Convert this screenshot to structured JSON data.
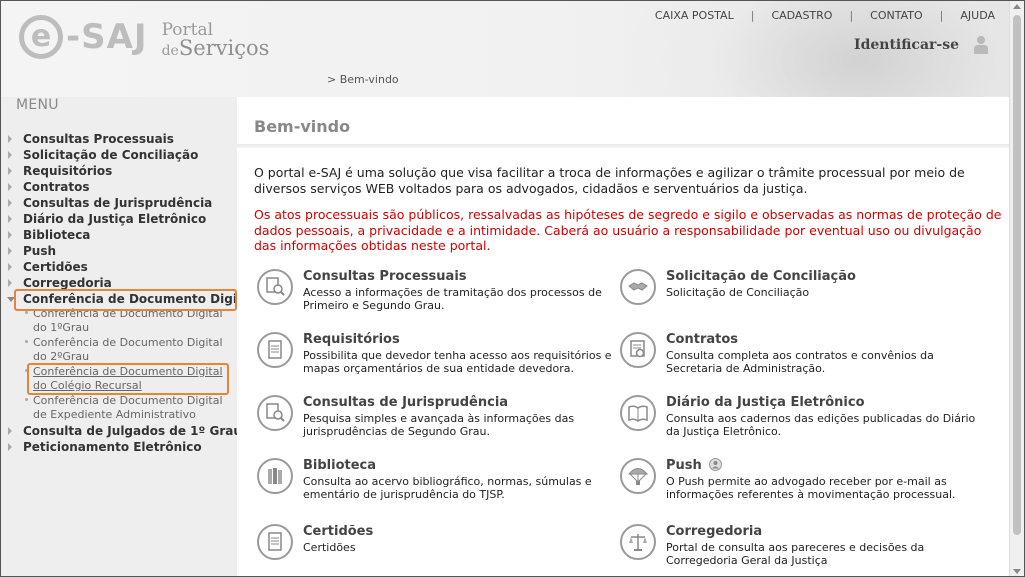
{
  "header": {
    "logo_text": "e-SAJ",
    "logo_portal_line1": "Portal",
    "logo_portal_line2_prefix": "de",
    "logo_portal_line2_main": "Serviços",
    "top_links": [
      "CAIXA POSTAL",
      "CADASTRO",
      "CONTATO",
      "AJUDA"
    ],
    "identify_label": "Identificar-se",
    "breadcrumb": "> Bem-vindo"
  },
  "sidebar": {
    "menu_title": "MENU",
    "items": [
      "Consultas Processuais",
      "Solicitação de Conciliação",
      "Requisitórios",
      "Contratos",
      "Consultas de Jurisprudência",
      "Diário da Justiça Eletrônico",
      "Biblioteca",
      "Push",
      "Certidões",
      "Corregedoria",
      "Conferência de Documento Digital"
    ],
    "subitems": [
      "Conferência de Documento Digital do 1ºGrau",
      "Conferência de Documento Digital do 2ºGrau",
      "Conferência de Documento Digital do Colégio Recursal",
      "Conferência de Documento Digital de Expediente Administrativo"
    ],
    "items_after": [
      "Consulta de Julgados de 1º Grau",
      "Peticionamento Eletrônico"
    ]
  },
  "main": {
    "title": "Bem-vindo",
    "intro": "O portal e-SAJ é uma solução que visa facilitar a troca de informações e agilizar o trâmite processual por meio de diversos serviços WEB voltados para os advogados, cidadãos e serventuários da justiça.",
    "warning": "Os atos processuais são públicos, ressalvadas as hipóteses de segredo e sigilo e observadas as normas de proteção de dados pessoais, a privacidade e a intimidade. Caberá ao usuário a responsabilidade por eventual uso ou divulgação das informações obtidas neste portal.",
    "services": [
      {
        "title": "Consultas Processuais",
        "desc": "Acesso a informações de tramitação dos processos de Primeiro e Segundo Grau.",
        "icon": "search-document-icon"
      },
      {
        "title": "Solicitação de Conciliação",
        "desc": "Solicitação de Conciliação",
        "icon": "handshake-icon"
      },
      {
        "title": "Requisitórios",
        "desc": "Possibilita que devedor tenha acesso aos requisitórios e mapas orçamentários de sua entidade devedora.",
        "icon": "document-icon"
      },
      {
        "title": "Contratos",
        "desc": "Consulta completa aos contratos e convênios da Secretaria de Administração.",
        "icon": "certificate-icon"
      },
      {
        "title": "Consultas de Jurisprudência",
        "desc": "Pesquisa simples e avançada às informações das jurisprudências de Segundo Grau.",
        "icon": "search-document-icon"
      },
      {
        "title": "Diário da Justiça Eletrônico",
        "desc": "Consulta aos cadernos das edições publicadas do Diário da Justiça Eletrônico.",
        "icon": "open-book-icon"
      },
      {
        "title": "Biblioteca",
        "desc": "Consulta ao acervo bibliográfico, normas, súmulas e ementário de jurisprudência do TJSP.",
        "icon": "books-icon"
      },
      {
        "title": "Push",
        "desc": "O Push permite ao advogado receber por e-mail as informações referentes à movimentação processual.",
        "icon": "parachute-icon"
      },
      {
        "title": "Certidões",
        "desc": "Certidões",
        "icon": "document-icon"
      },
      {
        "title": "Corregedoria",
        "desc": "Portal de consulta aos pareceres e decisões da Corregedoria Geral da Justiça",
        "icon": "scales-icon"
      }
    ]
  },
  "colors": {
    "warning_text": "#d10000",
    "highlight_box": "#e8833a",
    "sidebar_bg": "#eeeeee"
  }
}
